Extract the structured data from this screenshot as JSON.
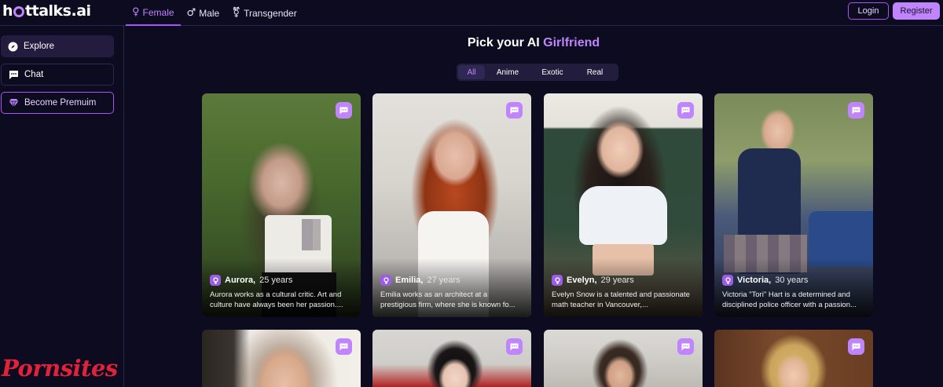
{
  "brand": {
    "logo_text": "hottalks.ai"
  },
  "gender_tabs": [
    {
      "label": "Female",
      "icon": "female-icon",
      "active": true
    },
    {
      "label": "Male",
      "icon": "male-icon",
      "active": false
    },
    {
      "label": "Transgender",
      "icon": "transgender-icon",
      "active": false
    }
  ],
  "auth": {
    "login_label": "Login",
    "register_label": "Register"
  },
  "sidebar": {
    "items": [
      {
        "label": "Explore",
        "icon": "compass-icon"
      },
      {
        "label": "Chat",
        "icon": "chat-icon"
      },
      {
        "label": "Become Premuim",
        "icon": "diamond-icon"
      }
    ]
  },
  "main": {
    "heading_prefix": "Pick your AI ",
    "heading_accent": "Girlfriend",
    "categories": [
      "All",
      "Anime",
      "Exotic",
      "Real"
    ],
    "active_category": "All"
  },
  "cards": [
    {
      "name": "Aurora,",
      "age": "25 years",
      "desc": "Aurora works as a cultural critic. Art and culture have always been her passion...."
    },
    {
      "name": "Emilia,",
      "age": "27 years",
      "desc": "Emilia works as an architect at a prestigious firm, where she is known fo..."
    },
    {
      "name": "Evelyn,",
      "age": "29 years",
      "desc": "Evelyn Snow is a talented and passionate math teacher in Vancouver,..."
    },
    {
      "name": "Victoria,",
      "age": "30 years",
      "desc": "Victoria \"Tori\" Hart is a determined and disciplined police officer with a passion..."
    }
  ],
  "watermark": "Pornsites",
  "colors": {
    "accent": "#c084fc",
    "background": "#0d0b1f",
    "watermark": "#e0233a"
  }
}
